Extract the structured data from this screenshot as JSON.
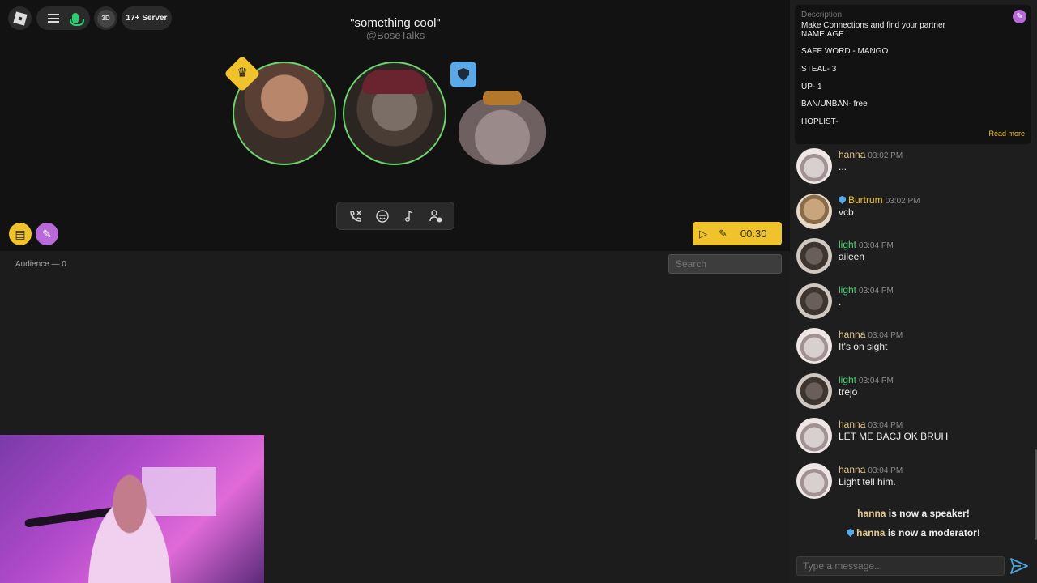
{
  "top_bar": {
    "server_label": "17+ Server",
    "avatar_initials": "3D"
  },
  "room": {
    "title": "\"something cool\"",
    "host": "@BoseTalks"
  },
  "timer": {
    "time": "00:30"
  },
  "audience": {
    "label": "Audience — 0"
  },
  "search": {
    "placeholder": "Search"
  },
  "description": {
    "label": "Description",
    "text": "Make Connections and find your partner\n NAME,AGE\n\nSAFE WORD - MANGO\n\nSTEAL- 3\n\nUP- 1\n\n BAN/UNBAN- free\n\nHOPLIST-",
    "read_more": "Read more"
  },
  "messages": [
    {
      "user": "hanna",
      "time": "03:02 PM",
      "text": "..."
    },
    {
      "user": "Burtrum",
      "time": "03:02 PM",
      "text": "vcb"
    },
    {
      "user": "light",
      "time": "03:04 PM",
      "text": "aileen"
    },
    {
      "user": "light",
      "time": "03:04 PM",
      "text": "."
    },
    {
      "user": "hanna",
      "time": "03:04 PM",
      "text": "It's on sight"
    },
    {
      "user": "light",
      "time": "03:04 PM",
      "text": "trejo"
    },
    {
      "user": "hanna",
      "time": "03:04 PM",
      "text": "LET ME BACJ OK BRUH"
    },
    {
      "user": "hanna",
      "time": "03:04 PM",
      "text": "Light tell him."
    }
  ],
  "system_messages": [
    {
      "name": "hanna",
      "text": " is now a speaker!"
    },
    {
      "name": "hanna",
      "text": " is now a moderator!"
    }
  ],
  "composer": {
    "placeholder": "Type a message..."
  },
  "colors": {
    "accent": "#f0c22b",
    "speaking_ring": "#6dd56d",
    "moderator": "#5aa8e6",
    "pen": "#b86ad8"
  },
  "icons": [
    "roblox-logo-icon",
    "menu-icon",
    "microphone-icon",
    "crown-icon",
    "shield-icon",
    "end-call-icon",
    "emoji-icon",
    "music-icon",
    "add-user-icon",
    "notes-icon",
    "pencil-icon",
    "play-icon",
    "send-icon"
  ]
}
